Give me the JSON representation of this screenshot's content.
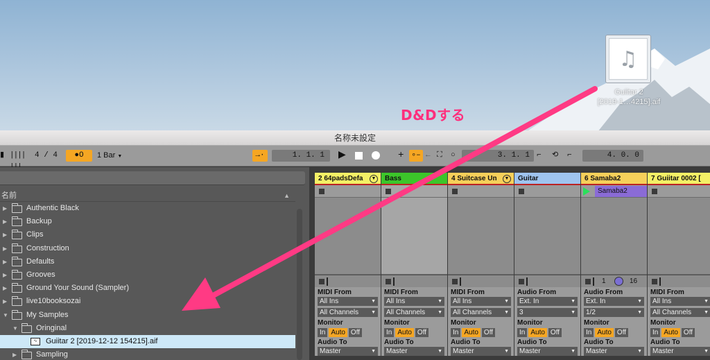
{
  "desktop": {
    "file_icon": "music-note-icon",
    "file_name_line1": "Guiitar 2",
    "file_name_line2": "[2019-1…4215].aif",
    "annotation": "D&Dする"
  },
  "window": {
    "title": "名称未設定"
  },
  "transport": {
    "meter": "4 / 4",
    "metronome": "●O",
    "quantize": "1 Bar",
    "position": "1.   1.   1",
    "loop_start": "3.   1.   1",
    "loop_length": "4.   0.   0",
    "accent_color": "#f5a623"
  },
  "browser": {
    "header": "名前",
    "items": [
      {
        "label": "Authentic Black",
        "icon": "folder-icon",
        "expanded": false,
        "depth": 0
      },
      {
        "label": "Backup",
        "icon": "backup-icon",
        "expanded": false,
        "depth": 0
      },
      {
        "label": "Clips",
        "icon": "folder-icon",
        "expanded": false,
        "depth": 0
      },
      {
        "label": "Construction",
        "icon": "folder-icon",
        "expanded": false,
        "depth": 0
      },
      {
        "label": "Defaults",
        "icon": "folder-icon",
        "expanded": false,
        "depth": 0
      },
      {
        "label": "Grooves",
        "icon": "folder-icon",
        "expanded": false,
        "depth": 0
      },
      {
        "label": "Ground Your Sound (Sampler)",
        "icon": "folder-icon",
        "expanded": false,
        "depth": 0
      },
      {
        "label": "live10booksozai",
        "icon": "folder-icon",
        "expanded": false,
        "depth": 0
      },
      {
        "label": "My Samples",
        "icon": "folder-icon",
        "expanded": true,
        "depth": 0
      },
      {
        "label": "Oringinal",
        "icon": "folder-icon",
        "expanded": true,
        "depth": 1
      },
      {
        "label": "Guiitar 2 [2019-12-12 154215].aif",
        "icon": "audio-file-icon",
        "selected": true,
        "depth": 2
      },
      {
        "label": "Sampling",
        "icon": "folder-icon",
        "expanded": false,
        "depth": 1
      }
    ]
  },
  "tracks": [
    {
      "name": "2 64padsDefa",
      "color": "#f4f066",
      "type": "midi",
      "from_label": "MIDI From",
      "from": "All Ins",
      "channel": "All Channels",
      "monitor_label": "Monitor",
      "in": "In",
      "auto": "Auto",
      "off": "Off",
      "to_label": "Audio To",
      "to": "Master"
    },
    {
      "name": "Bass",
      "color": "#3cc52a",
      "type": "midi",
      "from_label": "MIDI From",
      "from": "All Ins",
      "channel": "All Channels",
      "monitor_label": "Monitor",
      "in": "In",
      "auto": "Auto",
      "off": "Off",
      "to_label": "Audio To",
      "to": "Master"
    },
    {
      "name": "4 Suitcase Un",
      "color": "#f6d05a",
      "type": "midi",
      "from_label": "MIDI From",
      "from": "All Ins",
      "channel": "All Channels",
      "monitor_label": "Monitor",
      "in": "In",
      "auto": "Auto",
      "off": "Off",
      "to_label": "Audio To",
      "to": "Master"
    },
    {
      "name": "Guitar",
      "color": "#9fc4ef",
      "type": "audio",
      "from_label": "Audio From",
      "from": "Ext. In",
      "channel": "3",
      "monitor_label": "Monitor",
      "in": "In",
      "auto": "Auto",
      "off": "Off",
      "to_label": "Audio To",
      "to": "Master"
    },
    {
      "name": "6 Samaba2",
      "color": "#f6d05a",
      "type": "audio",
      "clip": "Samaba2",
      "num1": "1",
      "num2": "16",
      "from_label": "Audio From",
      "from": "Ext. In",
      "channel": "1/2",
      "monitor_label": "Monitor",
      "in": "In",
      "auto": "Auto",
      "off": "Off",
      "to_label": "Audio To",
      "to": "Master"
    },
    {
      "name": "7 Guiitar 0002 [",
      "color": "#f4f066",
      "type": "midi",
      "from_label": "MIDI From",
      "from": "All Ins",
      "channel": "All Channels",
      "monitor_label": "Monitor",
      "in": "In",
      "auto": "Auto",
      "off": "Off",
      "to_label": "Audio To",
      "to": "Master"
    }
  ]
}
